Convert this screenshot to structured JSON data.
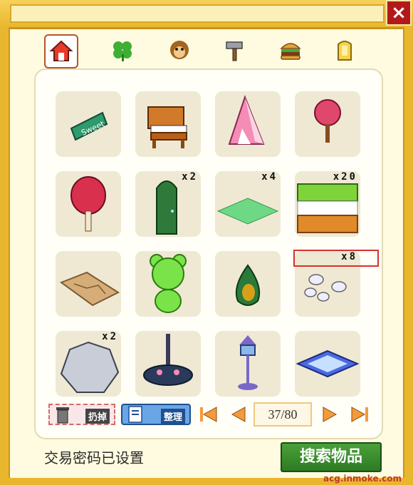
{
  "window": {
    "close_glyph": "×"
  },
  "tabs": [
    {
      "name": "house-icon",
      "active": true
    },
    {
      "name": "clover-icon",
      "active": false
    },
    {
      "name": "monkey-face-icon",
      "active": false
    },
    {
      "name": "hammer-icon",
      "active": false
    },
    {
      "name": "burger-icon",
      "active": false
    },
    {
      "name": "gold-card-icon",
      "active": false
    }
  ],
  "items": [
    {
      "name": "sweet-sign",
      "qty": "",
      "sign_text": "Sweet"
    },
    {
      "name": "wooden-piano",
      "qty": ""
    },
    {
      "name": "pink-tent",
      "qty": ""
    },
    {
      "name": "pink-blossom-tree-small",
      "qty": ""
    },
    {
      "name": "red-blossom-tree",
      "qty": ""
    },
    {
      "name": "green-door",
      "qty": "x2"
    },
    {
      "name": "grass-tile",
      "qty": "x4"
    },
    {
      "name": "grass-fence-block",
      "qty": "x20"
    },
    {
      "name": "cracked-floor-tile",
      "qty": ""
    },
    {
      "name": "green-bear-topiary",
      "qty": ""
    },
    {
      "name": "flower-seed-pod",
      "qty": ""
    },
    {
      "name": "white-pebbles",
      "qty": "x8"
    },
    {
      "name": "gray-rock",
      "qty": "x2"
    },
    {
      "name": "flower-fountain",
      "qty": ""
    },
    {
      "name": "bird-house-lamp",
      "qty": ""
    },
    {
      "name": "blue-star-mat",
      "qty": ""
    }
  ],
  "toolbar": {
    "discard_label": "扔掉",
    "sort_label": "整理",
    "page_current": "37",
    "page_total": "80"
  },
  "footer": {
    "status_text": "交易密码已设置",
    "search_label": "搜索物品",
    "watermark": "acg.inmoke.com"
  }
}
